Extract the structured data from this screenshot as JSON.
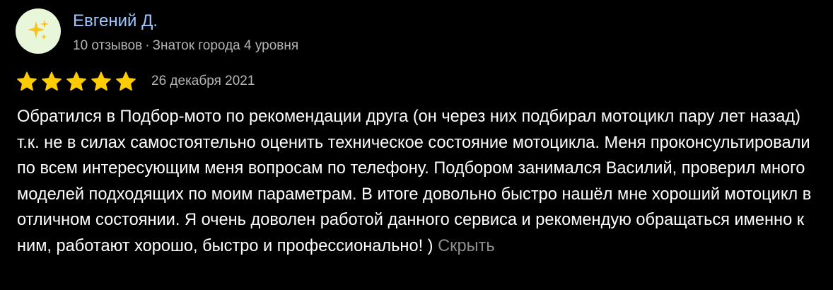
{
  "author": {
    "avatar_icon": "sparkles-icon",
    "avatar_bg": "#e8f6da",
    "name": "Евгений Д.",
    "reviews_count": "10 отзывов",
    "separator": "·",
    "level": "Знаток города 4 уровня"
  },
  "rating": {
    "stars": 5,
    "max": 5,
    "star_color": "#ffcc00",
    "star_icon": "star-icon"
  },
  "date": "26 декабря 2021",
  "text": "Обратился в Подбор-мото по рекомендации друга (он через них подбирал мотоцикл пару лет назад) т.к. не в силах самостоятельно оценить техническое состояние мотоцикла. Меня проконсультировали по всем интересующим меня вопросам по телефону. Подбором занимался Василий, проверил много моделей подходящих по моим параметрам. В итоге довольно быстро нашёл мне хороший мотоцикл в отличном состоянии. Я очень доволен работой данного сервиса и рекомендую обращаться именно к ним, работают хорошо, быстро и профессионально! )",
  "hide_link": "Скрыть"
}
